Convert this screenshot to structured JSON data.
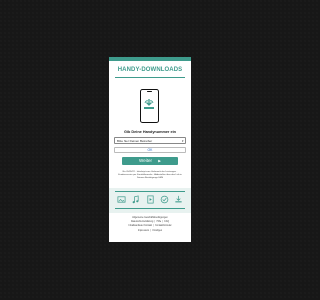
{
  "header": {
    "title": "HANDY-DOWNLOADS"
  },
  "phone_prompt": "Gib Deine Handynummer ein",
  "select": {
    "value": "Bitte hier Deinen Betreiber"
  },
  "ok_label": "OK",
  "weiter_label": "Weiter",
  "note_text": "Bis 05/05/22 · Infoskript zum Verbrauch der Leistungen · Kundenservice per Kontaktformular · Abbestellen über den Link in Deinem Bestätigungs-SMS",
  "links": {
    "row1": [
      "Allgemeine Geschäftsbedingungen"
    ],
    "row2": [
      "Datenschutzerklärung",
      "Hilfe",
      "FAQ"
    ],
    "row3": [
      "Inhaltsanbieter Kontakt",
      "Kontaktformular"
    ],
    "row4": [
      "Impressum",
      "Kündigen"
    ]
  },
  "icons": [
    "image-icon",
    "music-note-icon",
    "video-icon",
    "check-icon",
    "download-icon"
  ],
  "colors": {
    "accent": "#3e9b8c",
    "background": "#171717",
    "card": "#ffffff",
    "link": "#2a6ac8"
  }
}
